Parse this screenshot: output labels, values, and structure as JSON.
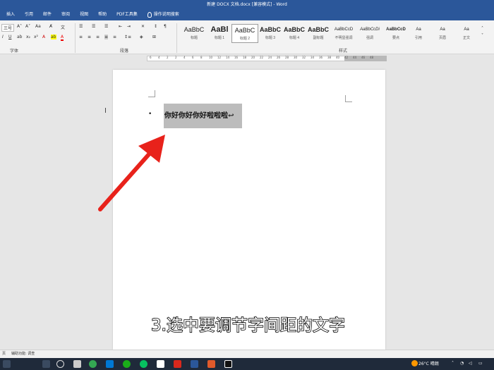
{
  "titlebar": {
    "title": "新建 DOCX 文档.docx [兼容模式] - Word"
  },
  "menu": {
    "tabs": [
      "插入",
      "引用",
      "邮件",
      "审阅",
      "视图",
      "帮助",
      "PDF工具集"
    ],
    "tell_me": "操作说明搜索"
  },
  "ribbon": {
    "font_size": "三号",
    "font_group_label": "字体",
    "paragraph_group_label": "段落",
    "styles_group_label": "样式",
    "styles": [
      {
        "sample": "AaBbC",
        "name": "标题"
      },
      {
        "sample": "AaBl",
        "name": "标题 1"
      },
      {
        "sample": "AaBbC",
        "name": "标题 2"
      },
      {
        "sample": "AaBbC",
        "name": "标题 3"
      },
      {
        "sample": "AaBbC",
        "name": "标题 4"
      },
      {
        "sample": "AaBbC",
        "name": "副标题"
      },
      {
        "sample": "AaBbCcD",
        "name": "不明显强调"
      },
      {
        "sample": "AaBbCcDi",
        "name": "强调"
      },
      {
        "sample": "AaBbCcD",
        "name": "要点"
      },
      {
        "sample": "Aa",
        "name": "引用"
      },
      {
        "sample": "Aa",
        "name": "页眉"
      },
      {
        "sample": "Aa",
        "name": "正文"
      }
    ]
  },
  "ruler": {
    "ticks": [
      "6",
      "4",
      "2",
      "2",
      "4",
      "6",
      "8",
      "10",
      "12",
      "14",
      "16",
      "18",
      "20",
      "22",
      "24",
      "26",
      "28",
      "30",
      "32",
      "34",
      "36",
      "38",
      "40",
      "42",
      "44",
      "46",
      "48"
    ]
  },
  "document": {
    "bullet": "•",
    "selected_text": "你好你好你好啦啦啦↩"
  },
  "caption": "3.选中要调节字间距的文字",
  "status": {
    "page": "页",
    "accessibility": "辅助功能: 调查"
  },
  "taskbar": {
    "weather": "26°C 晴朗"
  },
  "colors": {
    "title_blue": "#2b579a",
    "arrow_red": "#e8221b",
    "selection_gray": "#bcbcbc"
  }
}
